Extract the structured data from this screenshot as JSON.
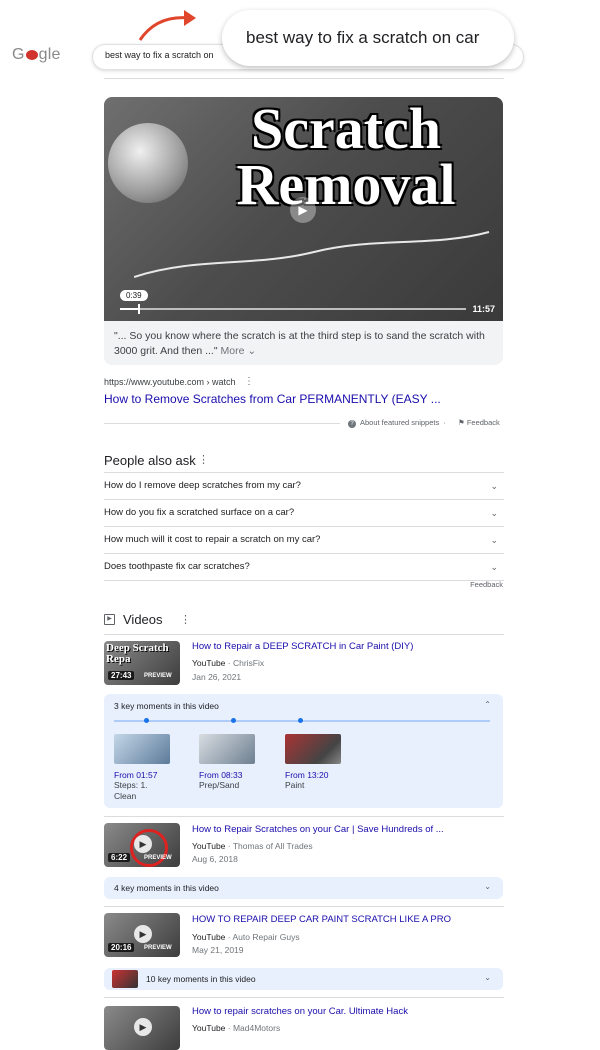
{
  "header": {
    "logo_text": "Google",
    "mini_query": "best way to fix a scratch on",
    "zoom_query": "best way to fix a scratch on car"
  },
  "featured": {
    "thumb_title_line1": "Scratch",
    "thumb_title_line2": "Removal",
    "timestamp": "0:39",
    "duration": "11:57",
    "progress": 0.054,
    "caption": "\"... So you know where the scratch is at the third step is to sand the scratch with 3000 grit. And then ...\"",
    "more_label": "More",
    "url": "https://www.youtube.com › watch",
    "title": "How to Remove Scratches from Car PERMANENTLY (EASY ...",
    "about_label": "About featured snippets",
    "feedback_label": "Feedback"
  },
  "paa": {
    "title": "People also ask",
    "questions": [
      "How do I remove deep scratches from my car?",
      "How do you fix a scratched surface on a car?",
      "How much will it cost to repair a scratch on my car?",
      "Does toothpaste fix car scratches?"
    ],
    "feedback_label": "Feedback"
  },
  "videos": {
    "title": "Videos",
    "items": [
      {
        "title": "How to Repair a DEEP SCRATCH in Car Paint (DIY)",
        "source": "YouTube",
        "channel": "ChrisFix",
        "date": "Jan 26, 2021",
        "duration": "27:43",
        "preview": "PREVIEW",
        "thumb_text": "Deep Scratch Repa",
        "moments_label": "3 key moments in this video",
        "moments": [
          {
            "from": "From 01:57",
            "label": "Steps: 1. Clean",
            "position": 0.08
          },
          {
            "from": "From 08:33",
            "label": "Prep/Sand",
            "position": 0.31
          },
          {
            "from": "From 13:20",
            "label": "Paint",
            "position": 0.49
          }
        ]
      },
      {
        "title": "How to Repair Scratches on your Car | Save Hundreds of ...",
        "source": "YouTube",
        "channel": "Thomas of All Trades",
        "date": "Aug 6, 2018",
        "duration": "6:22",
        "preview": "PREVIEW",
        "moments_label": "4 key moments in this video"
      },
      {
        "title": "HOW TO REPAIR DEEP CAR PAINT SCRATCH LIKE A PRO",
        "source": "YouTube",
        "channel": "Auto Repair Guys",
        "date": "May 21, 2019",
        "duration": "20:16",
        "preview": "PREVIEW",
        "moments_label": "10 key moments in this video"
      },
      {
        "title": "How to repair scratches on your Car. Ultimate Hack",
        "source": "YouTube",
        "channel": "Mad4Motors"
      }
    ]
  }
}
